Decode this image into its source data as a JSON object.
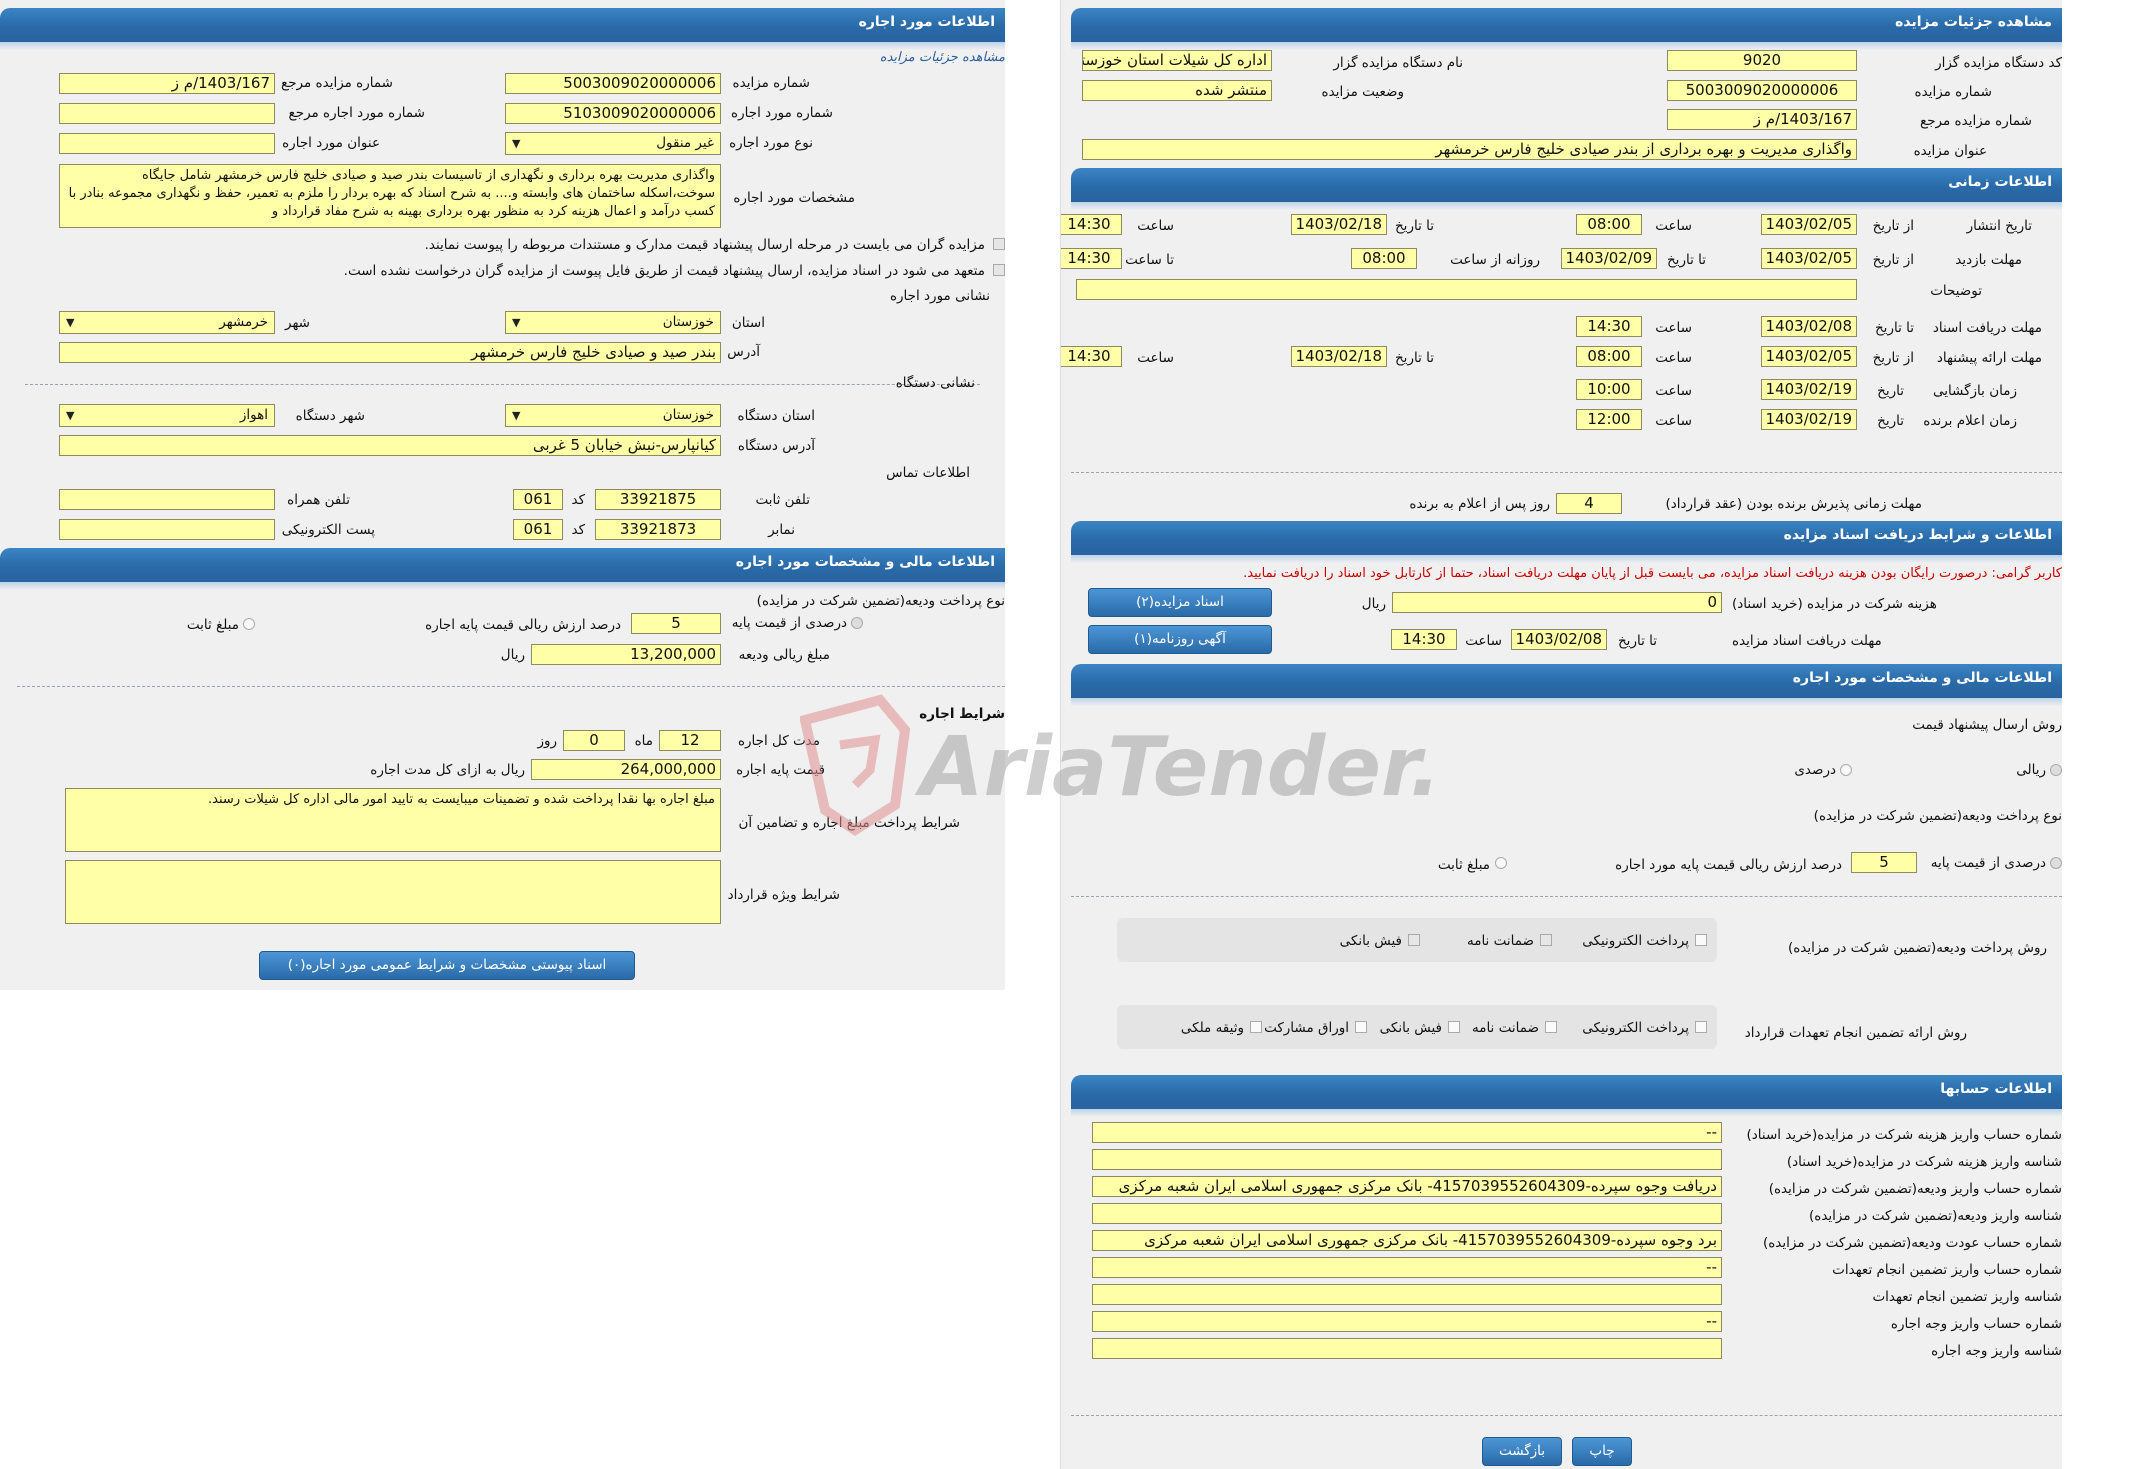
{
  "left": {
    "header": "اطلاعات مورد اجاره",
    "sublink": "مشاهده جزئیات مزایده",
    "auction_number_label": "شماره مزایده",
    "auction_number": "5003009020000006",
    "ref_number_label": "شماره مزایده مرجع",
    "ref_number": "1403/167/م ز",
    "lease_number_label": "شماره مورد اجاره",
    "lease_number": "5103009020000006",
    "lease_ref_label": "شماره مورد اجاره مرجع",
    "lease_ref": "",
    "lease_type_label": "نوع مورد اجاره",
    "lease_type": "غیر منقول",
    "lease_title_label": "عنوان مورد اجاره",
    "lease_title": "",
    "specs_label": "مشخصات مورد اجاره",
    "specs_text": "واگذاری مدیریت بهره برداری و نگهداری از تاسیسات بندر صید و صیادی خلیج فارس خرمشهر شامل جایگاه سوخت،اسکله ساختمان های وابسته و.... به شرح اسناد که بهره بردار را ملزم به تعمیر، حفظ و نگهداری مجموعه بنادر با کسب درآمد و اعمال هزینه کرد به منظور بهره برداری بهینه به شرح مفاد قرارداد و",
    "check1": "مزایده گران می بایست در مرحله ارسال پیشنهاد قیمت مدارک و مستندات مربوطه را پیوست نمایند.",
    "check2": "متعهد می شود در اسناد مزایده، ارسال پیشنهاد قیمت از طریق فایل پیوست از مزایده گران درخواست نشده است.",
    "address_section": "نشانی مورد اجاره",
    "province_label": "استان",
    "province": "خوزستان",
    "city_label": "شهر",
    "city": "خرمشهر",
    "address_label": "آدرس",
    "address": "بندر صید و صیادی خلیج فارس خرمشهر",
    "device_address_section": "نشانی دستگاه",
    "device_province_label": "استان دستگاه",
    "device_province": "خوزستان",
    "device_city_label": "شهر دستگاه",
    "device_city": "اهواز",
    "device_address_label": "آدرس دستگاه",
    "device_address": "کیانپارس-نبش خیابان 5 غربی",
    "contact_section": "اطلاعات تماس",
    "phone_label": "تلفن ثابت",
    "phone": "33921875",
    "code_label": "کد",
    "phone_code": "061",
    "mobile_label": "تلفن همراه",
    "mobile": "",
    "fax_label": "نمابر",
    "fax": "33921873",
    "fax_code": "061",
    "email_label": "پست الکترونیکی",
    "email": "",
    "fin_header": "اطلاعات مالی و مشخصات مورد اجاره",
    "deposit_type_label": "نوع پرداخت ودیعه(تضمین شرکت در مزایده)",
    "percent_base_label": "درصدی از قیمت پایه",
    "percent_value": "5",
    "percent_suffix": "درصد ارزش ریالی قیمت پایه اجاره",
    "fixed_amount_label": "مبلغ ثابت",
    "deposit_amount_label": "مبلغ ریالی ودیعه",
    "deposit_amount": "13,200,000",
    "rial": "ریال",
    "lease_terms_section": "شرایط اجاره",
    "total_duration_label": "مدت کل اجاره",
    "months": "12",
    "month_label": "ماه",
    "days": "0",
    "day_label": "روز",
    "base_price_label": "قیمت پایه اجاره",
    "base_price": "264,000,000",
    "base_price_suffix": "ریال به ازای کل مدت اجاره",
    "payment_terms_label": "شرایط پرداخت مبلغ اجاره و تضامین آن",
    "payment_terms": "مبلغ اجاره بها نقدا پرداخت شده و تضمینات میبایست به تایید امور مالی اداره کل شیلات رسند.",
    "special_terms_label": "شرایط ویژه قرارداد",
    "special_terms": "",
    "attach_button": "اسناد پیوستی مشخصات و شرایط عمومی مورد اجاره(۰)"
  },
  "right": {
    "header": "مشاهده جزئیات مزایده",
    "org_code_label": "کد دستگاه مزایده گزار",
    "org_code": "9020",
    "org_name_label": "نام دستگاه مزایده گزار",
    "org_name": "اداره کل شیلات استان خوزستان",
    "auction_number_label": "شماره مزایده",
    "auction_number": "5003009020000006",
    "status_label": "وضعیت مزایده",
    "status": "منتشر شده",
    "ref_number_label": "شماره مزایده مرجع",
    "ref_number": "1403/167/م ز",
    "title_label": "عنوان مزایده",
    "title": "واگذاری مدیریت و بهره برداری از بندر صیادی خلیج فارس خرمشهر",
    "time_header": "اطلاعات زمانی",
    "publish_label": "تاریخ انتشار",
    "from_date_label": "از تاریخ",
    "to_date_label": "تا تاریخ",
    "time_label": "ساعت",
    "to_time_label": "تا ساعت",
    "daily_from_label": "روزانه از ساعت",
    "publish_from": "1403/02/05",
    "publish_from_time": "08:00",
    "publish_to": "1403/02/18",
    "publish_to_time": "14:30",
    "visit_label": "مهلت بازدید",
    "visit_from": "1403/02/05",
    "visit_to": "1403/02/09",
    "visit_from_time": "08:00",
    "visit_to_time": "14:30",
    "desc_label": "توضیحات",
    "desc": "",
    "doc_deadline_label": "مهلت دریافت اسناد",
    "doc_to": "1403/02/08",
    "doc_to_time": "14:30",
    "offer_label": "مهلت ارائه پیشنهاد",
    "offer_from": "1403/02/05",
    "offer_from_time": "08:00",
    "offer_to": "1403/02/18",
    "offer_to_time": "14:30",
    "opening_label": "زمان بازگشایی",
    "date_label": "تاریخ",
    "opening_date": "1403/02/19",
    "opening_time": "10:00",
    "winner_label": "زمان اعلام برنده",
    "winner_date": "1403/02/19",
    "winner_time": "12:00",
    "acceptance_label": "مهلت زمانی پذیرش برنده بودن (عقد قرارداد)",
    "acceptance_days": "4",
    "acceptance_suffix": "روز پس از اعلام به برنده",
    "docs_header": "اطلاعات و شرایط دریافت اسناد مزایده",
    "notice": "کاربر گرامی: درصورت رایگان بودن هزینه دریافت اسناد مزایده، می بایست قبل از پایان مهلت دریافت اسناد، حتما از کارتابل خود اسناد را دریافت نمایید.",
    "fee_label": "هزینه شرکت در مزایده (خرید اسناد)",
    "fee": "0",
    "rial": "ریال",
    "docs_button": "اسناد مزایده(۲)",
    "doc_receive_label": "مهلت دریافت اسناد مزایده",
    "doc_receive_date": "1403/02/08",
    "doc_receive_time": "14:30",
    "news_button": "آگهی روزنامه(۱)",
    "fin_header": "اطلاعات مالی و مشخصات مورد اجاره",
    "offer_method_label": "روش ارسال پیشنهاد قیمت",
    "rial_option": "ریالی",
    "percent_option": "درصدی",
    "deposit_type_label": "نوع پرداخت ودیعه(تضمین شرکت در مزایده)",
    "percent_base_label": "درصدی از قیمت پایه",
    "percent_value": "5",
    "percent_suffix": "درصد ارزش ریالی قیمت پایه مورد اجاره",
    "fixed_amount_label": "مبلغ ثابت",
    "deposit_method_label": "روش پرداخت ودیعه(تضمین شرکت در مزایده)",
    "deposit_methods": [
      "پرداخت الکترونیکی",
      "ضمانت نامه",
      "فیش بانکی"
    ],
    "guarantee_label": "روش ارائه تضمین انجام تعهدات قرارداد",
    "guarantee_methods": [
      "پرداخت الکترونیکی",
      "ضمانت نامه",
      "فیش بانکی",
      "اوراق مشارکت",
      "وثیقه ملکی"
    ],
    "accounts_header": "اطلاعات حسابها",
    "accounts": [
      {
        "label": "شماره حساب واریز هزینه شرکت در مزایده(خرید اسناد)",
        "value": "--"
      },
      {
        "label": "شناسه واریز هزینه شرکت در مزایده(خرید اسناد)",
        "value": ""
      },
      {
        "label": "شماره حساب واریز ودیعه(تضمین شرکت در مزایده)",
        "value": "دریافت وجوه سپرده-4157039552604309- بانک مرکزی جمهوری اسلامی ایران شعبه مرکزی"
      },
      {
        "label": "شناسه واریز ودیعه(تضمین شرکت در مزایده)",
        "value": ""
      },
      {
        "label": "شماره حساب عودت ودیعه(تضمین شرکت در مزایده)",
        "value": "برد وجوه سپرده-4157039552604309- بانک مرکزی جمهوری اسلامی ایران شعبه مرکزی"
      },
      {
        "label": "شماره حساب واریز تضمین انجام تعهدات",
        "value": "--"
      },
      {
        "label": "شناسه واریز تضمین انجام تعهدات",
        "value": ""
      },
      {
        "label": "شماره حساب واریز وجه اجاره",
        "value": "--"
      },
      {
        "label": "شناسه واریز وجه اجاره",
        "value": ""
      }
    ],
    "print_button": "چاپ",
    "back_button": "بازگشت"
  },
  "watermark": "AriaTender.neT",
  "colors": {
    "header": "#2a6aa8",
    "field": "#ffffa8",
    "notice": "#cc0000"
  }
}
